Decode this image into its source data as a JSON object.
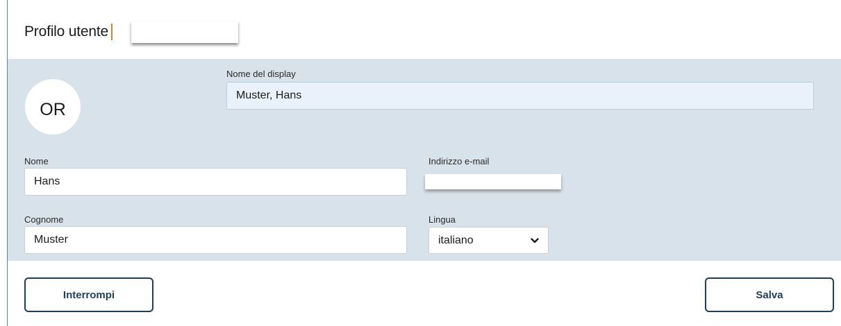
{
  "header": {
    "title": "Profilo utente"
  },
  "profile": {
    "avatar_initials": "OR",
    "display_name_label": "Nome del display",
    "display_name_value": "Muster, Hans"
  },
  "form": {
    "first_name_label": "Nome",
    "first_name_value": "Hans",
    "email_label": "Indirizzo e-mail",
    "last_name_label": "Cognome",
    "last_name_value": "Muster",
    "language_label": "Lingua",
    "language_value": "italiano"
  },
  "actions": {
    "cancel_label": "Interrompi",
    "save_label": "Salva"
  },
  "colors": {
    "panel_background": "#d8e2ea",
    "button_border": "#1d3d5c",
    "display_field_background": "#e9f2fa"
  },
  "icons": {
    "language_dropdown": "chevron-down-icon"
  }
}
